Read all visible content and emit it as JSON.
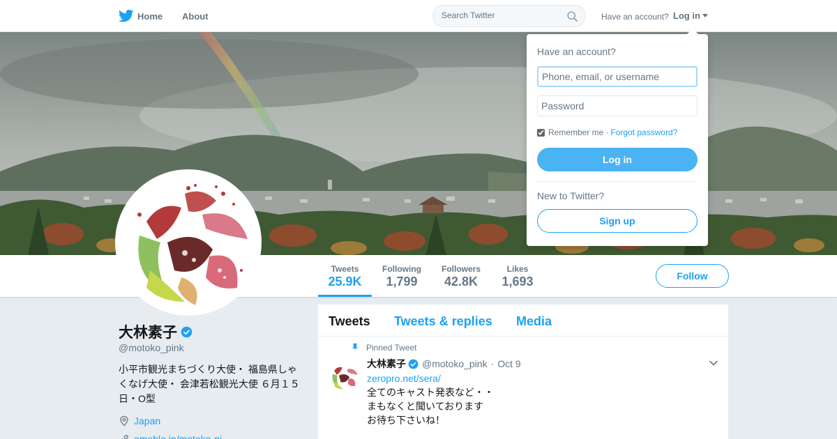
{
  "nav": {
    "home_label": "Home",
    "about_label": "About",
    "search_placeholder": "Search Twitter",
    "have_account": "Have an account?",
    "login_label": "Log in"
  },
  "profile": {
    "name": "大林素子",
    "screen_name": "@motoko_pink",
    "bio_lines": [
      "小平市観光まちづくり大使・ 福島県しゃ",
      "くなげ大使・ 会津若松観光大使 ６月１５",
      "日・O型"
    ],
    "location": "Japan",
    "url": "ameblo.jp/motoko-pi"
  },
  "stats": [
    {
      "label": "Tweets",
      "value": "25.9K",
      "active": true
    },
    {
      "label": "Following",
      "value": "1,799",
      "active": false
    },
    {
      "label": "Followers",
      "value": "42.8K",
      "active": false
    },
    {
      "label": "Likes",
      "value": "1,693",
      "active": false
    }
  ],
  "follow_label": "Follow",
  "timeline": {
    "tabs": [
      "Tweets",
      "Tweets & replies",
      "Media"
    ],
    "active_tab": "Tweets",
    "pinned_tweet": {
      "pinned_label": "Pinned Tweet",
      "name": "大林素子",
      "handle": "@motoko_pink",
      "dot": "·",
      "time": "Oct 9",
      "link": "zeropro.net/sera/",
      "lines": [
        "全てのキャスト発表など・・",
        "まもなくと聞いております",
        "お待ち下さいね！"
      ]
    }
  },
  "login_dropdown": {
    "title": "Have an account?",
    "username_placeholder": "Phone, email, or username",
    "password_placeholder": "Password",
    "remember_label": "Remember me",
    "separator": "·",
    "forgot_label": "Forgot password?",
    "login_button": "Log in",
    "new_to_twitter": "New to Twitter?",
    "signup_button": "Sign up"
  },
  "colors": {
    "brand_blue": "#1da1f2",
    "login_blue": "#4ab3f4",
    "muted_text": "#657786",
    "page_background": "#e6ecf0"
  }
}
